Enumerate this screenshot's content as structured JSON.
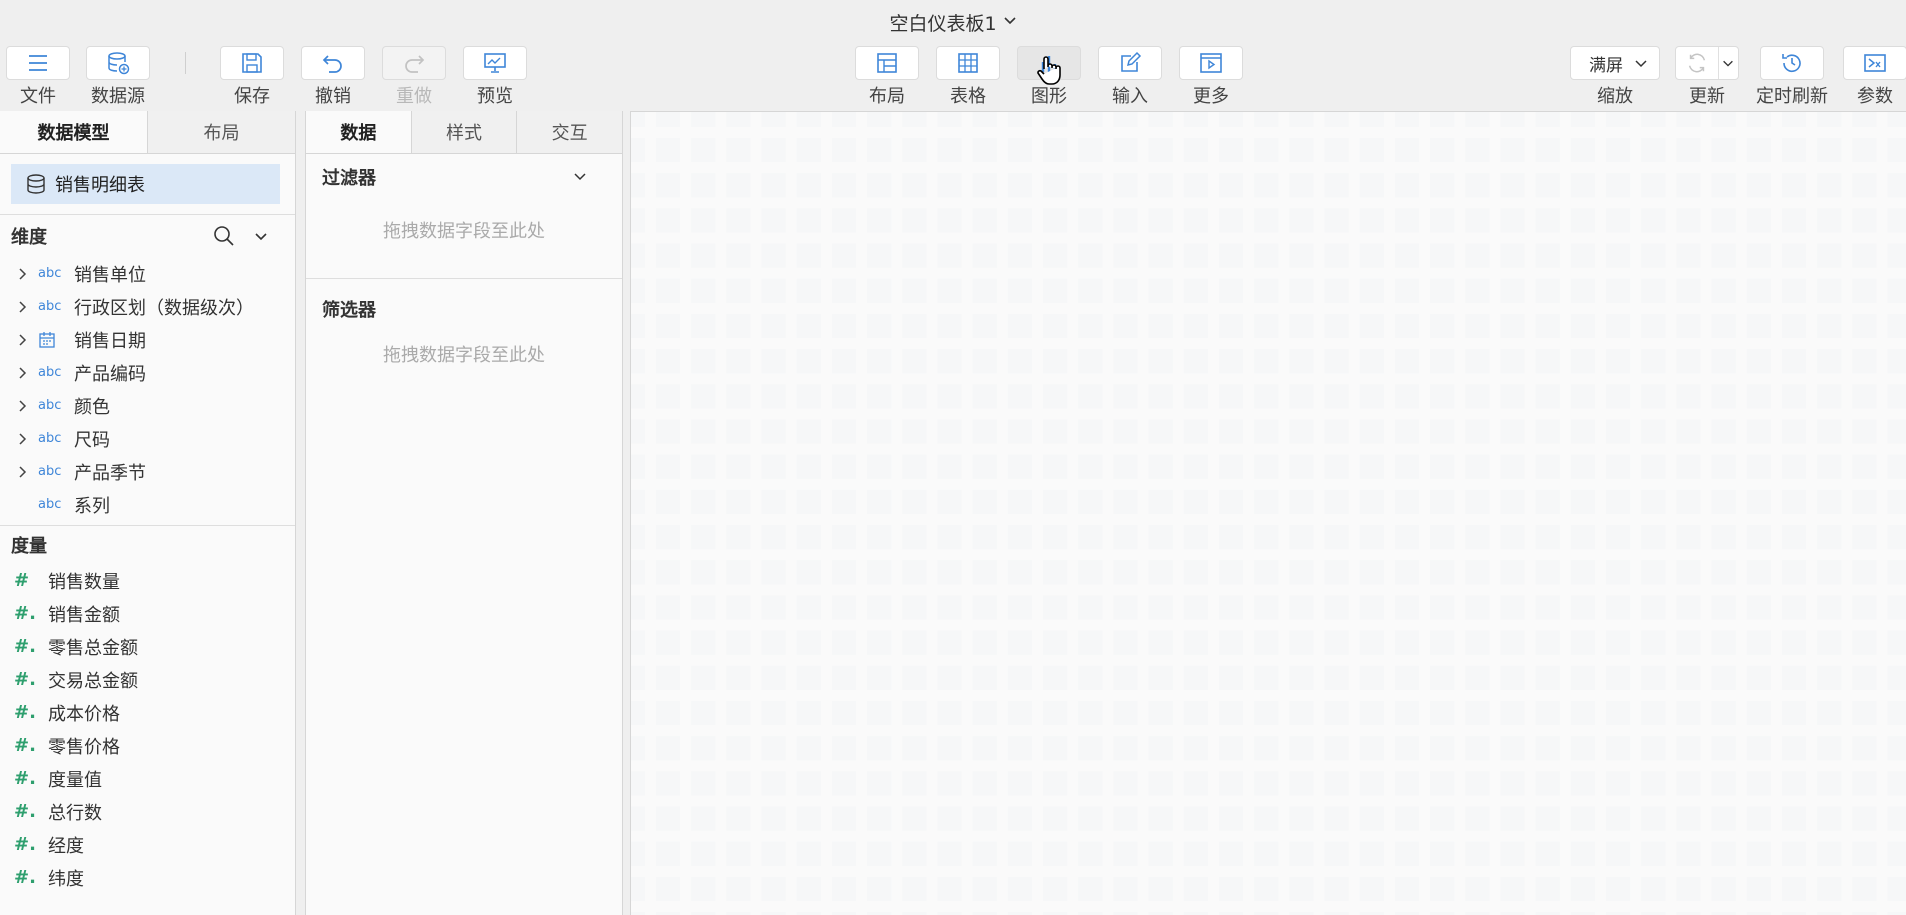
{
  "title": "空白仪表板1",
  "toolbar": {
    "file": "文件",
    "datasource": "数据源",
    "save": "保存",
    "undo": "撤销",
    "redo": "重做",
    "preview": "预览",
    "layout": "布局",
    "table": "表格",
    "chart": "图形",
    "input": "输入",
    "more": "更多",
    "zoom_value": "满屏",
    "zoom": "缩放",
    "refresh": "更新",
    "timed_refresh": "定时刷新",
    "params": "参数"
  },
  "left_panel": {
    "tabs": [
      "数据模型",
      "布局"
    ],
    "model": "销售明细表",
    "dimensions_title": "维度",
    "dimensions": [
      {
        "type": "abc",
        "label": "销售单位",
        "expandable": true
      },
      {
        "type": "abc",
        "label": "行政区划（数据级次）",
        "expandable": true
      },
      {
        "type": "date",
        "label": "销售日期",
        "expandable": true
      },
      {
        "type": "abc",
        "label": "产品编码",
        "expandable": true
      },
      {
        "type": "abc",
        "label": "颜色",
        "expandable": true
      },
      {
        "type": "abc",
        "label": "尺码",
        "expandable": true
      },
      {
        "type": "abc",
        "label": "产品季节",
        "expandable": true
      },
      {
        "type": "abc",
        "label": "系列",
        "expandable": false
      }
    ],
    "measures_title": "度量",
    "measures": [
      "销售数量",
      "销售金额",
      "零售总金额",
      "交易总金额",
      "成本价格",
      "零售价格",
      "度量值",
      "总行数",
      "经度",
      "纬度"
    ]
  },
  "mid_panel": {
    "tabs": [
      "数据",
      "样式",
      "交互"
    ],
    "filter_title": "过滤器",
    "filter_hint": "拖拽数据字段至此处",
    "selector_title": "筛选器",
    "selector_hint": "拖拽数据字段至此处"
  },
  "colors": {
    "accent": "#3f86d8",
    "measure": "#2e9f6e",
    "selected": "#dbe8f7"
  }
}
